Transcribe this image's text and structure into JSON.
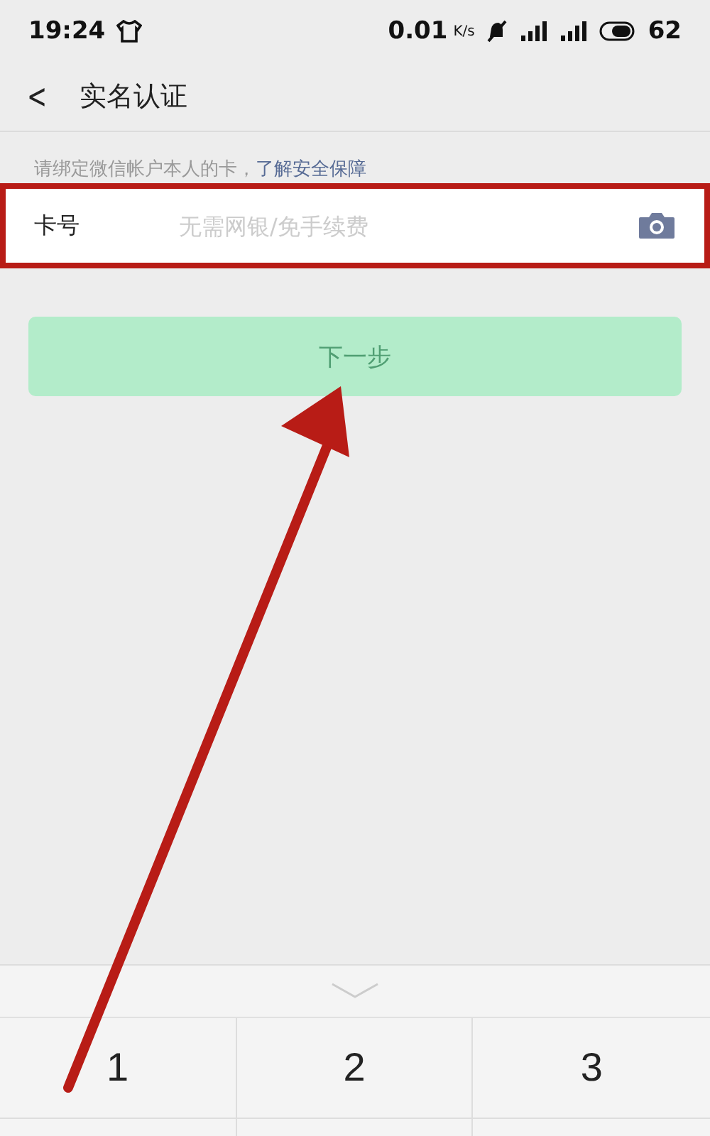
{
  "status_bar": {
    "time": "19:24",
    "speed": "0.01",
    "speed_unit": "K/s",
    "battery": "62"
  },
  "header": {
    "back": "<",
    "title": "实名认证"
  },
  "hint": {
    "text": "请绑定微信帐户本人的卡，",
    "link": "了解安全保障"
  },
  "card_field": {
    "label": "卡号",
    "placeholder": "无需网银/免手续费",
    "highlighted": true
  },
  "next_button": {
    "label": "下一步",
    "disabled": true
  },
  "keypad": {
    "keys": [
      "1",
      "2",
      "3"
    ]
  }
}
